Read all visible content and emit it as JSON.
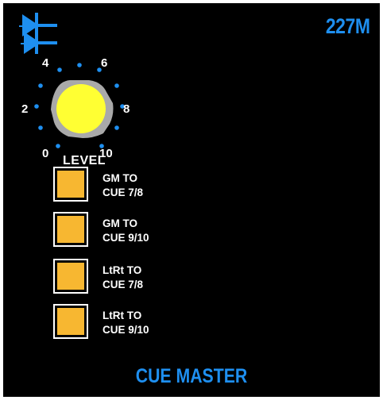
{
  "panel": {
    "model": "227M",
    "title": "CUE MASTER",
    "logo_icon": "dolby-style-logo-icon",
    "accent_color": "#1e8ff0",
    "button_color": "#f7b731",
    "knob_color": "#ffff33"
  },
  "knob": {
    "label": "LEVEL",
    "scale": [
      "0",
      "2",
      "4",
      "6",
      "8",
      "10"
    ]
  },
  "buttons": [
    {
      "line1": "GM TO",
      "line2": "CUE 7/8"
    },
    {
      "line1": "GM TO",
      "line2": "CUE 9/10"
    },
    {
      "line1": "LtRt TO",
      "line2": "CUE 7/8"
    },
    {
      "line1": "LtRt TO",
      "line2": "CUE 9/10"
    }
  ]
}
